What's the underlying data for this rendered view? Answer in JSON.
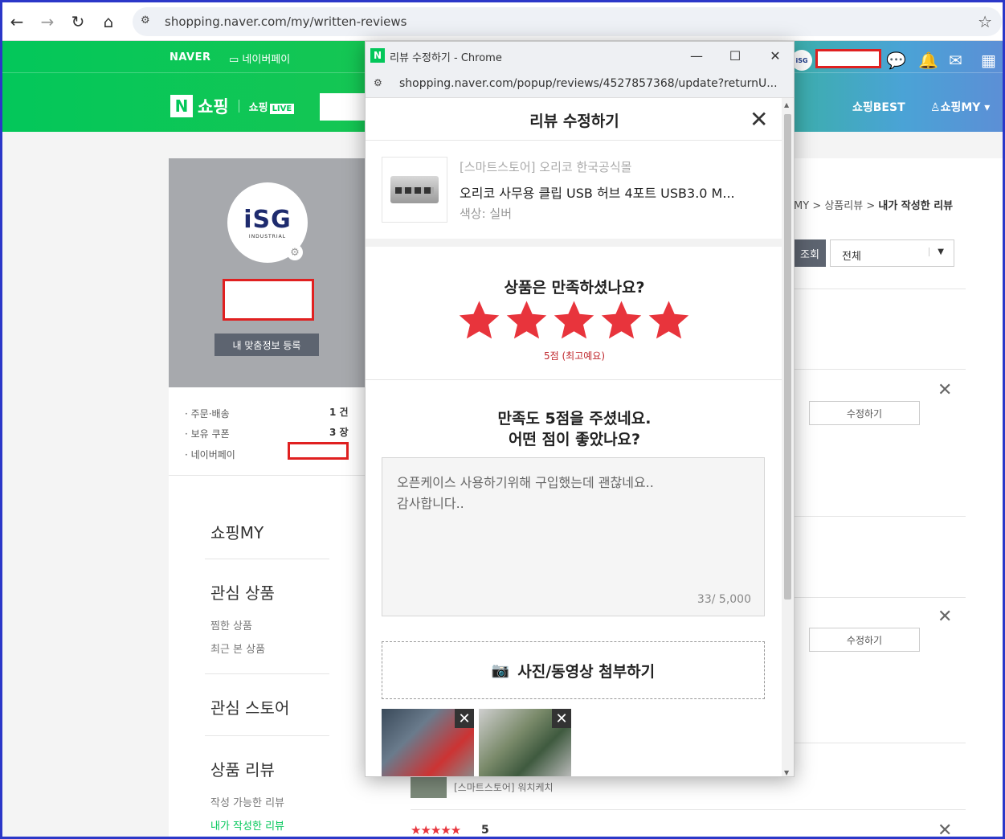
{
  "browser": {
    "url": "shopping.naver.com/my/written-reviews"
  },
  "header": {
    "naver": "NAVER",
    "npay": "네이버페이",
    "shopping": "쇼핑",
    "shopping_live": "쇼핑",
    "live_badge": "LIVE",
    "avatar_text": "iSG",
    "shop_best": "쇼핑BEST",
    "shop_my": "쇼핑MY"
  },
  "profile": {
    "brand_main": "iSG",
    "brand_sub": "INDUSTRIAL",
    "custom_info_button": "내 맞춤정보 등록"
  },
  "stats": [
    {
      "label": "· 주문·배송",
      "value": "1 건"
    },
    {
      "label": "· 보유 쿠폰",
      "value": "3 장"
    },
    {
      "label": "· 네이버페이",
      "value": ""
    }
  ],
  "menu": {
    "shopping_my": "쇼핑MY",
    "interest_products": "관심 상품",
    "wished": "찜한 상품",
    "recent": "최근 본 상품",
    "interest_store": "관심 스토어",
    "product_review": "상품 리뷰",
    "writable": "작성 가능한 리뷰",
    "written": "내가 작성한 리뷰"
  },
  "content": {
    "breadcrumb_1": "MY",
    "breadcrumb_2": "상품리뷰",
    "breadcrumb_3": "내가 작성한 리뷰",
    "inquire": "조회",
    "filter": "전체",
    "edit_label": "수정하기",
    "bottom_store": "[스마트스토어] 워치케치",
    "bottom_score": "5"
  },
  "popup": {
    "window_title": "리뷰 수정하기 - Chrome",
    "url": "shopping.naver.com/popup/reviews/4527857368/update?returnU...",
    "heading": "리뷰 수정하기",
    "product_store": "[스마트스토어] 오리코 한국공식몰",
    "product_name": "오리코 사무용 클립 USB 허브 4포트 USB3.0 M...",
    "product_option": "색상: 실버",
    "satisfaction_q": "상품은 만족하셨나요?",
    "rating": 5,
    "score_text": "5점 (최고예요)",
    "comment_q1": "만족도 5점을 주셨네요.",
    "comment_q2": "어떤 점이 좋았나요?",
    "review_line1": "오픈케이스 사용하기위해 구입했는데 괜찮네요..",
    "review_line2": "감사합니다..",
    "char_count": "33",
    "char_max": "/ 5,000",
    "attach_label": "사진/동영상 첨부하기"
  },
  "colors": {
    "naver_green": "#03c75a",
    "star_red": "#e8343c",
    "redact_red": "#e02020"
  }
}
